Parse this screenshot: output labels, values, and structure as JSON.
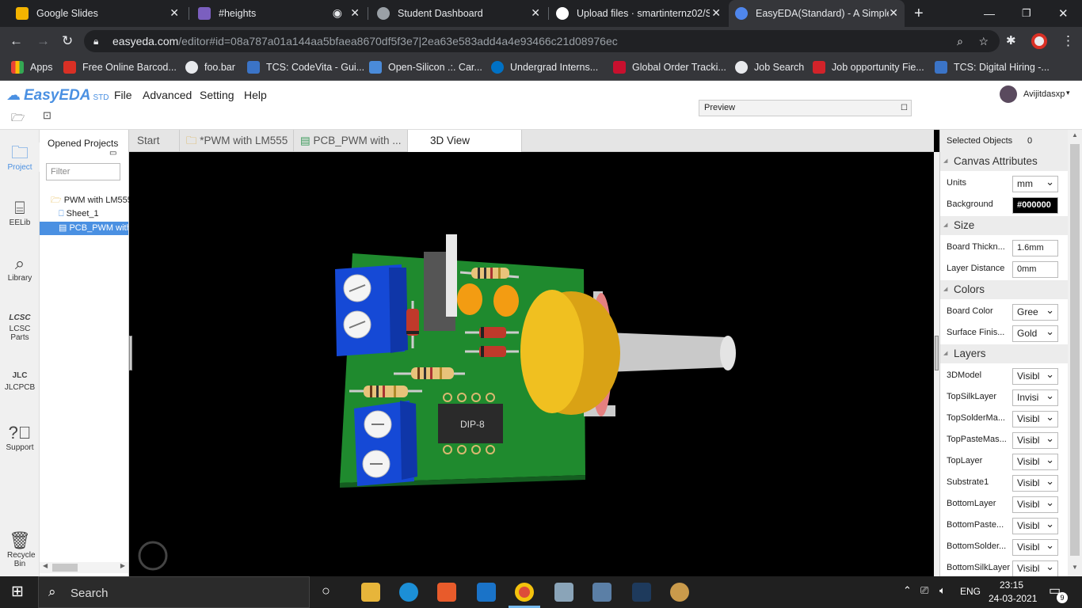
{
  "browser": {
    "tabs": [
      {
        "title": "Google Slides"
      },
      {
        "title": "#heights"
      },
      {
        "title": "Student Dashboard"
      },
      {
        "title": "Upload files · smartinternz02/S"
      },
      {
        "title": "EasyEDA(Standard) - A Simple"
      }
    ],
    "url_domain": "easyeda.com",
    "url_path": "/editor#id=08a787a01a144aa5bfaea8670df5f3e7|2ea63e583add4a4e93466c21d08976ec",
    "bookmarks": [
      "Apps",
      "Free Online Barcod...",
      "foo.bar",
      "TCS: CodeVita - Gui...",
      "Open-Silicon .:. Car...",
      "Undergrad Interns...",
      "Global Order Tracki...",
      "Job Search",
      "Job opportunity Fie...",
      "TCS: Digital Hiring -..."
    ]
  },
  "app": {
    "logo": "EasyEDA",
    "logo_suffix": "STD",
    "menu": [
      "File",
      "Advanced",
      "Setting",
      "Help"
    ],
    "preview_label": "Preview",
    "user": "Avijitdasxp"
  },
  "sidebar": {
    "items": [
      {
        "label": "Project",
        "icon": "folder-icon"
      },
      {
        "label": "EELib",
        "icon": "chip-icon"
      },
      {
        "label": "Library",
        "icon": "magnifier-icon"
      },
      {
        "label": "LCSC Parts",
        "icon": "lcsc-icon"
      },
      {
        "label": "JLCPCB",
        "icon": "jlc-icon"
      },
      {
        "label": "Support",
        "icon": "help-icon"
      },
      {
        "label": "Recycle Bin",
        "icon": "trash-icon"
      }
    ]
  },
  "project_panel": {
    "title": "Opened Projects",
    "filter_placeholder": "Filter",
    "tree": [
      "PWM with LM555",
      "Sheet_1",
      "PCB_PWM with"
    ]
  },
  "editor_tabs": [
    "Start",
    "*PWM with LM555",
    "PCB_PWM with ...",
    "3D View"
  ],
  "canvas": {
    "chip_label": "DIP-8",
    "background": "#000000",
    "board_color": "#1f8a2e",
    "terminal_color": "#1549d6",
    "knob_color": "#f0c020"
  },
  "right_panel": {
    "selected_label": "Selected Objects",
    "selected_count": "0",
    "sections": {
      "canvas": "Canvas Attributes",
      "size": "Size",
      "colors": "Colors",
      "layers": "Layers"
    },
    "units_label": "Units",
    "units_value": "mm",
    "background_label": "Background",
    "background_value": "#000000",
    "board_thickness_label": "Board Thickn...",
    "board_thickness_value": "1.6mm",
    "layer_distance_label": "Layer Distance",
    "layer_distance_value": "0mm",
    "board_color_label": "Board Color",
    "board_color_value": "Gree",
    "surface_label": "Surface Finis...",
    "surface_value": "Gold",
    "layers": [
      {
        "name": "3DModel",
        "value": "Visibl"
      },
      {
        "name": "TopSilkLayer",
        "value": "Invisi"
      },
      {
        "name": "TopSolderMa...",
        "value": "Visibl"
      },
      {
        "name": "TopPasteMas...",
        "value": "Visibl"
      },
      {
        "name": "TopLayer",
        "value": "Visibl"
      },
      {
        "name": "Substrate1",
        "value": "Visibl"
      },
      {
        "name": "BottomLayer",
        "value": "Visibl"
      },
      {
        "name": "BottomPaste...",
        "value": "Visibl"
      },
      {
        "name": "BottomSolder...",
        "value": "Visibl"
      },
      {
        "name": "BottomSilkLayer",
        "value": "Visibl"
      }
    ]
  },
  "taskbar": {
    "search": "Search",
    "lang": "ENG",
    "time": "23:15",
    "date": "24-03-2021",
    "notifications": "9"
  }
}
